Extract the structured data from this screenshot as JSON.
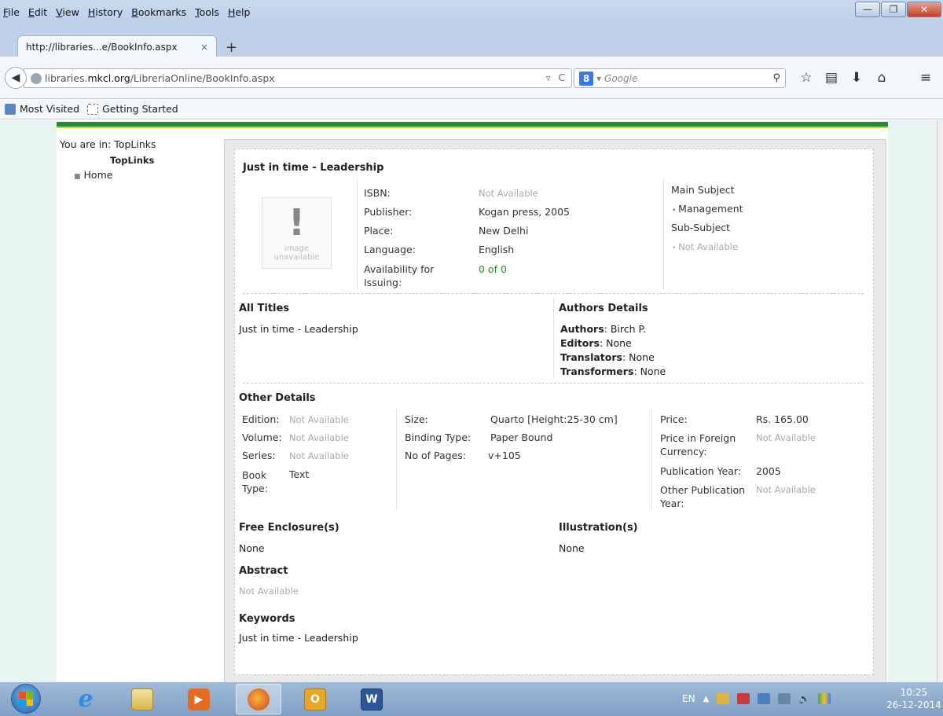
{
  "menubar": {
    "items": [
      {
        "label": "File"
      },
      {
        "label": "Edit"
      },
      {
        "label": "View"
      },
      {
        "label": "History"
      },
      {
        "label": "Bookmarks"
      },
      {
        "label": "Tools"
      },
      {
        "label": "Help"
      }
    ]
  },
  "tab": {
    "title": "http://libraries...e/BookInfo.aspx",
    "close": "×",
    "new_tab": "+"
  },
  "navbar": {
    "url_host": "libraries.mkcl.org",
    "url_prefix_host_part": "libraries.",
    "url_host_bold": "mkcl.org",
    "url_path": "/LibreriaOnline/BookInfo.aspx",
    "search_engine_badge": "8",
    "search_placeholder": "Google"
  },
  "bookmarks": {
    "items": [
      {
        "label": "Most Visited"
      },
      {
        "label": "Getting Started"
      }
    ]
  },
  "sidebar": {
    "breadcrumb": "You are in: TopLinks",
    "heading": "TopLinks",
    "links": [
      {
        "label": "Home"
      }
    ]
  },
  "book": {
    "title": "Just in time - Leadership",
    "image_caption_1": "image",
    "image_caption_2": "unavailable",
    "fields": {
      "isbn_label": "ISBN:",
      "isbn": "Not Available",
      "publisher_label": "Publisher:",
      "publisher": "Kogan press, 2005",
      "place_label": "Place:",
      "place": "New Delhi",
      "language_label": "Language:",
      "language": "English",
      "availability_label_1": "Availability for",
      "availability_label_2": "Issuing:",
      "availability": "0 of 0"
    },
    "subject": {
      "main_label": "Main Subject",
      "main": "Management",
      "sub_label": "Sub-Subject",
      "sub": "Not Available"
    },
    "all_titles": {
      "heading": "All Titles",
      "value": "Just in time - Leadership"
    },
    "authors_details": {
      "heading": "Authors Details",
      "authors_label": "Authors",
      "authors": "Birch P.",
      "editors_label": "Editors",
      "editors": "None",
      "translators_label": "Translators",
      "translators": "None",
      "transformers_label": "Transformers",
      "transformers": "None"
    },
    "other_details": {
      "heading": "Other Details",
      "edition_label": "Edition:",
      "edition": "Not Available",
      "volume_label": "Volume:",
      "volume": "Not Available",
      "series_label": "Series:",
      "series": "Not Available",
      "book_type_label_1": "Book",
      "book_type_label_2": "Type:",
      "book_type": "Text",
      "size_label": "Size:",
      "size": "Quarto [Height:25-30 cm]",
      "binding_label": "Binding Type:",
      "binding": "Paper Bound",
      "pages_label": "No of Pages:",
      "pages": "v+105",
      "price_label": "Price:",
      "price": "Rs. 165.00",
      "foreign_label_1": "Price in Foreign",
      "foreign_label_2": "Currency:",
      "foreign": "Not Available",
      "pub_year_label": "Publication Year:",
      "pub_year": "2005",
      "other_pub_label_1": "Other Publication",
      "other_pub_label_2": "Year:",
      "other_pub": "Not Available"
    },
    "free_enclosures": {
      "heading": "Free Enclosure(s)",
      "value": "None"
    },
    "illustrations": {
      "heading": "Illustration(s)",
      "value": "None"
    },
    "abstract": {
      "heading": "Abstract",
      "value": "Not Available"
    },
    "keywords": {
      "heading": "Keywords",
      "value": "Just in time - Leadership"
    }
  },
  "taskbar": {
    "language": "EN",
    "time": "10:25",
    "date": "26-12-2014"
  },
  "colors": {
    "brand_green": "#1f8a3a",
    "accent_yellow": "#e8c33b",
    "side_bg": "#e6f5ef",
    "availability_green": "#2c8a2c",
    "muted_text": "#aaaaaa"
  }
}
